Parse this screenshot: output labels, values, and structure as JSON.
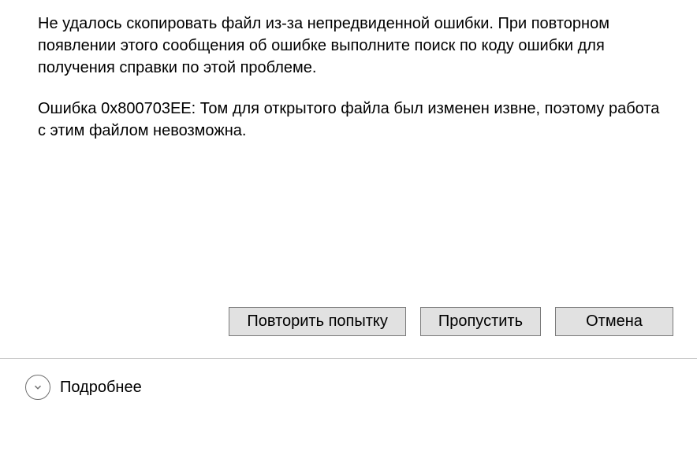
{
  "dialog": {
    "error_message": "Не удалось скопировать файл из-за непредвиденной ошибки. При повторном появлении этого сообщения об ошибке выполните поиск по коду ошибки для получения справки по этой проблеме.",
    "error_code_message": "Ошибка 0x800703EE: Том для открытого файла был изменен извне, поэтому работа с этим файлом невозможна."
  },
  "buttons": {
    "retry": "Повторить попытку",
    "skip": "Пропустить",
    "cancel": "Отмена"
  },
  "details": {
    "label": "Подробнее"
  }
}
